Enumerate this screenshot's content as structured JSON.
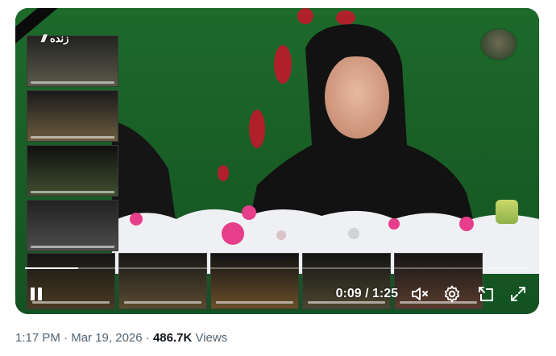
{
  "player": {
    "current_time": "0:09",
    "separator": " / ",
    "duration": "1:25",
    "progress_fraction": 0.106,
    "muted": true
  },
  "overlay": {
    "live_label": "زنده"
  },
  "tweet_meta": {
    "time": "1:17 PM",
    "dot1": " · ",
    "date": "Mar 19, 2026",
    "dot2": " · ",
    "views_count": "486.7K",
    "views_label": " Views"
  },
  "icons": {
    "pause": "pause-icon",
    "mute": "volume-muted-icon",
    "settings": "gear-icon",
    "pip": "picture-in-picture-icon",
    "fullscreen": "fullscreen-icon"
  },
  "colors": {
    "backdrop_green": "#1f6b2a",
    "meta_grey": "#536471",
    "views_dark": "#0f1419"
  }
}
